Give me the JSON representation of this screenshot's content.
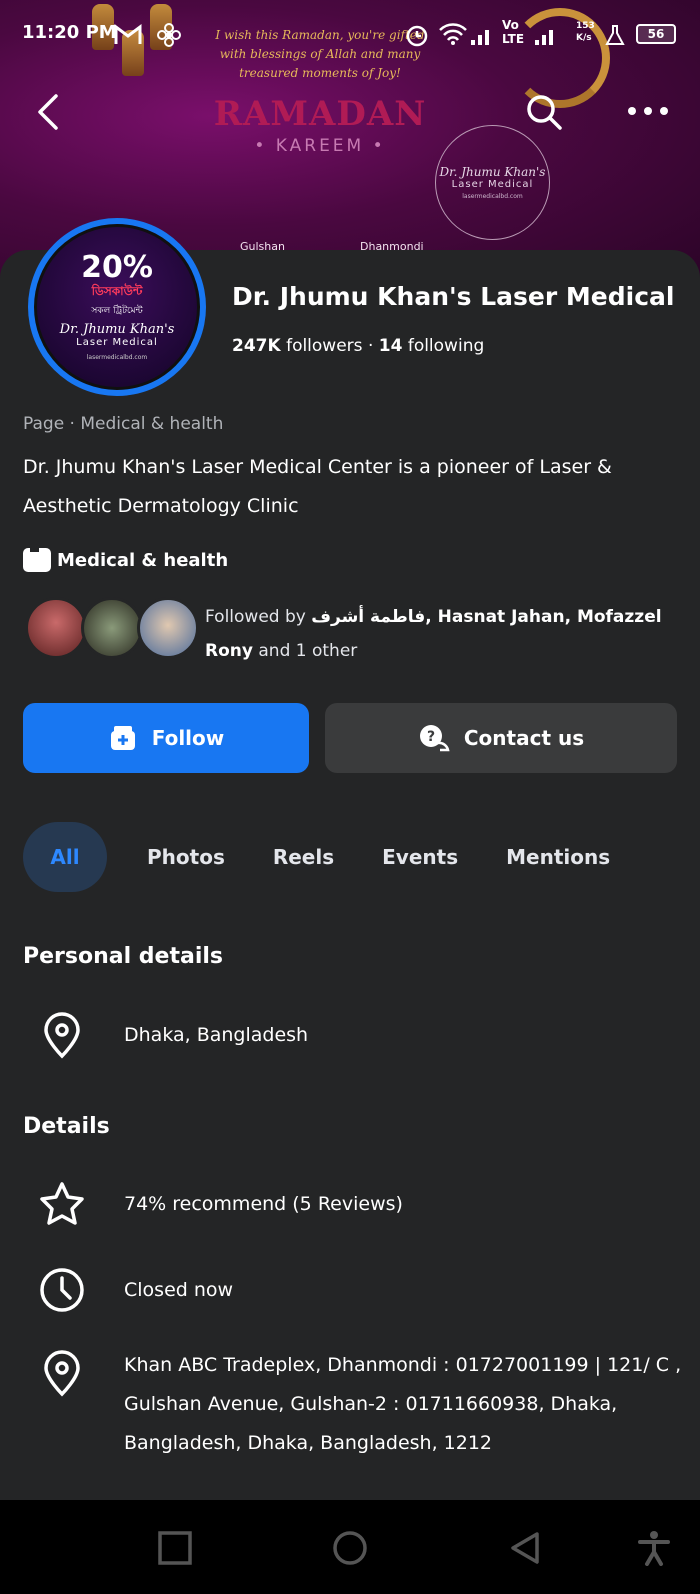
{
  "status_bar": {
    "time": "11:20 PM",
    "network": "Vo LTE",
    "speed": "153 K/s",
    "battery": "56"
  },
  "cover": {
    "greeting": "I wish this Ramadan, you're gifted with blessings of Allah and many treasured moments of Joy!",
    "title": "RAMADAN",
    "subtitle": "• KAREEM •",
    "logo_name": "Dr. Jhumu Khan's",
    "logo_sub": "Laser Medical",
    "logo_url": "lasermedicalbd.com",
    "location_left": "Gulshan",
    "location_right": "Dhanmondi"
  },
  "avatar": {
    "percent": "20%",
    "bn_line1": "ডিসকাউন্ট",
    "bn_line2": "সকল ট্রিটমেন্ট",
    "name": "Dr. Jhumu Khan's",
    "sub": "Laser Medical",
    "url": "lasermedicalbd.com"
  },
  "page": {
    "name": "Dr. Jhumu Khan's Laser Medical",
    "followers": "247K",
    "followers_label": "followers",
    "separator": "·",
    "following": "14",
    "following_label": "following",
    "category_line": "Page · Medical & health",
    "bio": "Dr. Jhumu Khan's Laser Medical Center is a pioneer of Laser & Aesthetic Dermatology Clinic",
    "category": "Medical & health"
  },
  "followed_by": {
    "prefix": "Followed by",
    "names": "فاطمة أشرف, Hasnat Jahan, Mofazzel Rony",
    "suffix": "and 1 other"
  },
  "buttons": {
    "follow": "Follow",
    "contact": "Contact us"
  },
  "tabs": [
    "All",
    "Photos",
    "Reels",
    "Events",
    "Mentions"
  ],
  "personal_details": {
    "title": "Personal details",
    "location": "Dhaka, Bangladesh"
  },
  "details": {
    "title": "Details",
    "recommend": "74% recommend (5 Reviews)",
    "hours": "Closed now",
    "address": "Khan ABC Tradeplex, Dhanmondi : 01727001199 | 121/ C , Gulshan Avenue, Gulshan-2 : 01711660938, Dhaka, Bangladesh, Dhaka, Bangladesh, 1212"
  },
  "colors": {
    "accent": "#1877f2",
    "background": "#242526",
    "tab_active_bg": "#263951"
  }
}
